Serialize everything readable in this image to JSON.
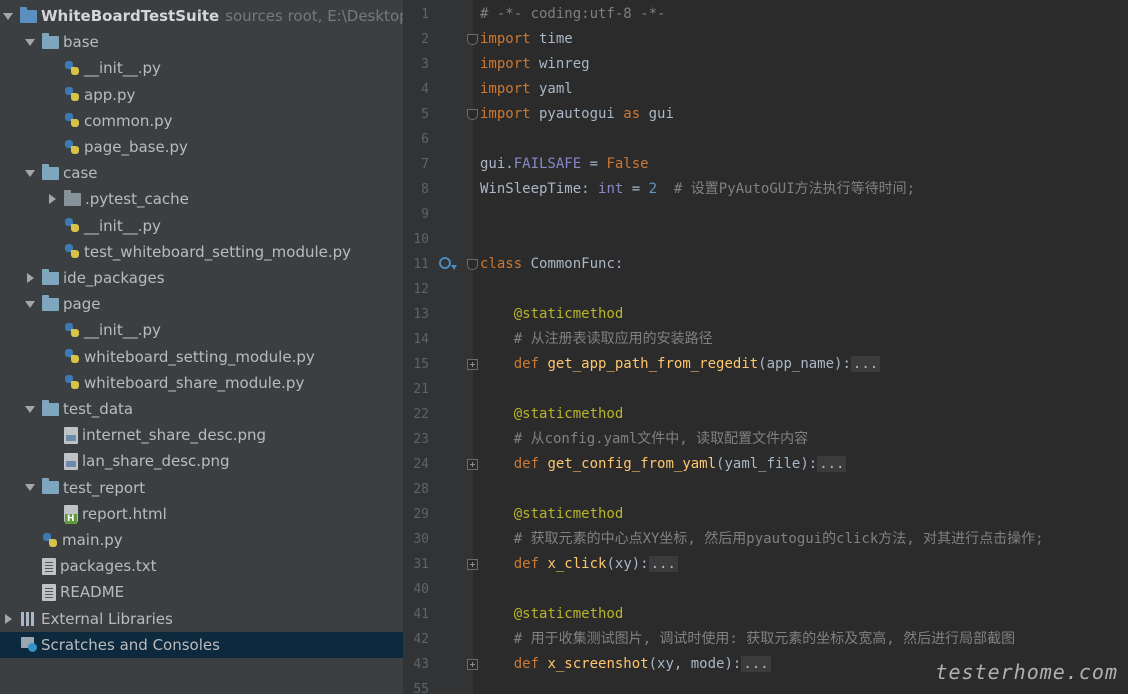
{
  "tree": {
    "items": [
      {
        "label": "WhiteBoardTestSuite",
        "hint": "sources root,  E:\\Desktop\\",
        "arrow": "down",
        "icon": "root-folder-icon",
        "indent": 0
      },
      {
        "label": "base",
        "arrow": "down",
        "icon": "folder-icon",
        "indent": 1
      },
      {
        "label": "__init__.py",
        "arrow": "",
        "icon": "python-file-icon",
        "indent": 2
      },
      {
        "label": "app.py",
        "arrow": "",
        "icon": "python-file-icon",
        "indent": 2
      },
      {
        "label": "common.py",
        "arrow": "",
        "icon": "python-file-icon",
        "indent": 2
      },
      {
        "label": "page_base.py",
        "arrow": "",
        "icon": "python-file-icon",
        "indent": 2
      },
      {
        "label": "case",
        "arrow": "down",
        "icon": "folder-icon",
        "indent": 1
      },
      {
        "label": ".pytest_cache",
        "arrow": "right",
        "icon": "plain-folder-icon",
        "indent": 2
      },
      {
        "label": "__init__.py",
        "arrow": "",
        "icon": "python-file-icon",
        "indent": 2
      },
      {
        "label": "test_whiteboard_setting_module.py",
        "arrow": "",
        "icon": "python-file-icon",
        "indent": 2
      },
      {
        "label": "ide_packages",
        "arrow": "right",
        "icon": "folder-icon",
        "indent": 1
      },
      {
        "label": "page",
        "arrow": "down",
        "icon": "folder-icon",
        "indent": 1
      },
      {
        "label": "__init__.py",
        "arrow": "",
        "icon": "python-file-icon",
        "indent": 2
      },
      {
        "label": "whiteboard_setting_module.py",
        "arrow": "",
        "icon": "python-file-icon",
        "indent": 2
      },
      {
        "label": "whiteboard_share_module.py",
        "arrow": "",
        "icon": "python-file-icon",
        "indent": 2
      },
      {
        "label": "test_data",
        "arrow": "down",
        "icon": "folder-icon",
        "indent": 1
      },
      {
        "label": "internet_share_desc.png",
        "arrow": "",
        "icon": "image-file-icon",
        "indent": 2
      },
      {
        "label": "lan_share_desc.png",
        "arrow": "",
        "icon": "image-file-icon",
        "indent": 2
      },
      {
        "label": "test_report",
        "arrow": "down",
        "icon": "folder-icon",
        "indent": 1
      },
      {
        "label": "report.html",
        "arrow": "",
        "icon": "html-file-icon",
        "indent": 2
      },
      {
        "label": "main.py",
        "arrow": "",
        "icon": "python-file-icon",
        "indent": 1
      },
      {
        "label": "packages.txt",
        "arrow": "",
        "icon": "text-file-icon",
        "indent": 1
      },
      {
        "label": "README",
        "arrow": "",
        "icon": "text-file-icon",
        "indent": 1
      },
      {
        "label": "External Libraries",
        "arrow": "right",
        "icon": "libraries-icon",
        "indent": 0
      },
      {
        "label": "Scratches and Consoles",
        "arrow": "",
        "icon": "scratches-icon",
        "indent": 0,
        "selected": true
      }
    ]
  },
  "editor": {
    "lines": [
      {
        "n": "1",
        "tokens": [
          [
            "cm",
            "# -*- coding:utf-8 -*-"
          ]
        ]
      },
      {
        "n": "2",
        "fold": "open",
        "tokens": [
          [
            "kw",
            "import"
          ],
          [
            "",
            " time"
          ]
        ]
      },
      {
        "n": "3",
        "tokens": [
          [
            "kw",
            "import"
          ],
          [
            "",
            " winreg"
          ]
        ]
      },
      {
        "n": "4",
        "tokens": [
          [
            "kw",
            "import"
          ],
          [
            "",
            " yaml"
          ]
        ]
      },
      {
        "n": "5",
        "fold": "open",
        "tokens": [
          [
            "kw",
            "import"
          ],
          [
            "",
            " pyautogui "
          ],
          [
            "kw",
            "as"
          ],
          [
            "",
            " gui"
          ]
        ]
      },
      {
        "n": "6",
        "tokens": []
      },
      {
        "n": "7",
        "tokens": [
          [
            "",
            "gui."
          ],
          [
            "bi",
            "FAILSAFE"
          ],
          [
            "",
            " = "
          ],
          [
            "const",
            "False"
          ]
        ]
      },
      {
        "n": "8",
        "tokens": [
          [
            "",
            "WinSleepTime: "
          ],
          [
            "bi",
            "int"
          ],
          [
            "",
            " = "
          ],
          [
            "num",
            "2"
          ],
          [
            "",
            "  "
          ],
          [
            "cm",
            "# 设置PyAutoGUI方法执行等待时间;"
          ]
        ]
      },
      {
        "n": "9",
        "tokens": []
      },
      {
        "n": "10",
        "tokens": []
      },
      {
        "n": "11",
        "fold": "open",
        "gutter": "breakpoint-icon",
        "tokens": [
          [
            "kw",
            "class"
          ],
          [
            "",
            " CommonFunc:"
          ]
        ]
      },
      {
        "n": "12",
        "tokens": []
      },
      {
        "n": "13",
        "tokens": [
          [
            "",
            "    "
          ],
          [
            "dec",
            "@staticmethod"
          ]
        ]
      },
      {
        "n": "14",
        "tokens": [
          [
            "",
            "    "
          ],
          [
            "cm",
            "# 从注册表读取应用的安装路径"
          ]
        ]
      },
      {
        "n": "15",
        "fold": "plus",
        "tokens": [
          [
            "",
            "    "
          ],
          [
            "kw",
            "def"
          ],
          [
            "",
            " "
          ],
          [
            "fn",
            "get_app_path_from_regedit"
          ],
          [
            "",
            "(app_name):"
          ],
          [
            "foldph",
            "..."
          ]
        ]
      },
      {
        "n": "21",
        "tokens": []
      },
      {
        "n": "22",
        "tokens": [
          [
            "",
            "    "
          ],
          [
            "dec",
            "@staticmethod"
          ]
        ]
      },
      {
        "n": "23",
        "tokens": [
          [
            "",
            "    "
          ],
          [
            "cm",
            "# 从config.yaml文件中, 读取配置文件内容"
          ]
        ]
      },
      {
        "n": "24",
        "fold": "plus",
        "tokens": [
          [
            "",
            "    "
          ],
          [
            "kw",
            "def"
          ],
          [
            "",
            " "
          ],
          [
            "fn",
            "get_config_from_yaml"
          ],
          [
            "",
            "(yaml_file):"
          ],
          [
            "foldph",
            "..."
          ]
        ]
      },
      {
        "n": "28",
        "tokens": []
      },
      {
        "n": "29",
        "tokens": [
          [
            "",
            "    "
          ],
          [
            "dec",
            "@staticmethod"
          ]
        ]
      },
      {
        "n": "30",
        "tokens": [
          [
            "",
            "    "
          ],
          [
            "cm",
            "# 获取元素的中心点XY坐标, 然后用pyautogui的click方法, 对其进行点击操作;"
          ]
        ]
      },
      {
        "n": "31",
        "fold": "plus",
        "tokens": [
          [
            "",
            "    "
          ],
          [
            "kw",
            "def"
          ],
          [
            "",
            " "
          ],
          [
            "fn",
            "x_click"
          ],
          [
            "",
            "(xy):"
          ],
          [
            "foldph",
            "..."
          ]
        ]
      },
      {
        "n": "40",
        "tokens": []
      },
      {
        "n": "41",
        "tokens": [
          [
            "",
            "    "
          ],
          [
            "dec",
            "@staticmethod"
          ]
        ]
      },
      {
        "n": "42",
        "tokens": [
          [
            "",
            "    "
          ],
          [
            "cm",
            "# 用于收集测试图片, 调试时使用: 获取元素的坐标及宽高, 然后进行局部截图"
          ]
        ]
      },
      {
        "n": "43",
        "fold": "plus",
        "tokens": [
          [
            "",
            "    "
          ],
          [
            "kw",
            "def"
          ],
          [
            "",
            " "
          ],
          [
            "fn",
            "x_screenshot"
          ],
          [
            "",
            "(xy, mode):"
          ],
          [
            "foldph",
            "..."
          ]
        ]
      },
      {
        "n": "55",
        "tokens": []
      }
    ]
  },
  "watermark": "testerhome.com"
}
